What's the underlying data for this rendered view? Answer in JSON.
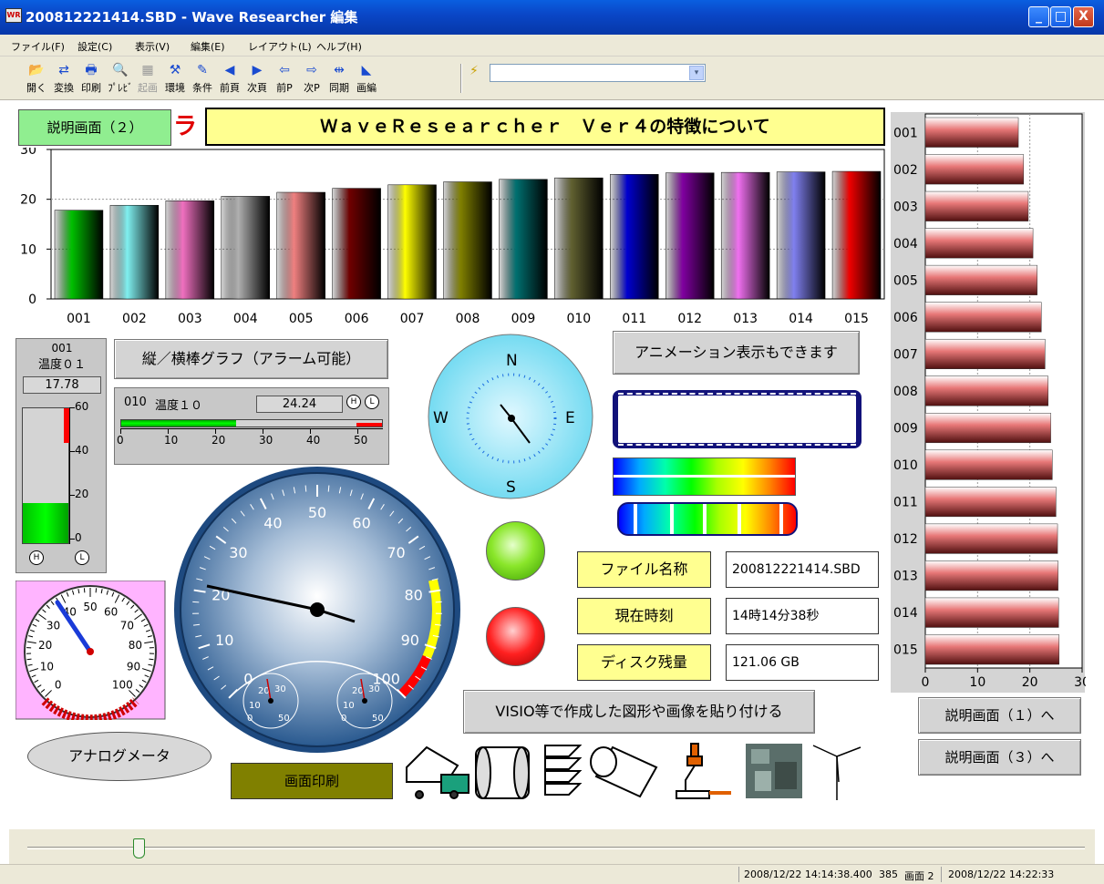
{
  "window": {
    "title": "200812221414.SBD - Wave Researcher 編集",
    "icon": "app-icon",
    "min": "_",
    "max": "□",
    "close": "X"
  },
  "menu": [
    "ファイル(F)",
    "設定(C)",
    "表示(V)",
    "編集(E)",
    "レイアウト(L)",
    "ヘルプ(H)"
  ],
  "toolbar": [
    {
      "label": "開く",
      "icon": "📂",
      "enabled": true
    },
    {
      "label": "変換",
      "icon": "⇄",
      "enabled": true
    },
    {
      "label": "印刷",
      "icon": "🖶",
      "enabled": true
    },
    {
      "label": "ﾌﾟﾚﾋﾞ",
      "icon": "🔍",
      "enabled": true
    },
    {
      "label": "起画",
      "icon": "▦",
      "enabled": false
    },
    {
      "label": "環境",
      "icon": "⚒",
      "enabled": true
    },
    {
      "label": "条件",
      "icon": "✎",
      "enabled": true
    },
    {
      "label": "前頁",
      "icon": "◀",
      "enabled": true
    },
    {
      "label": "次頁",
      "icon": "▶",
      "enabled": true
    },
    {
      "label": "前P",
      "icon": "⇦",
      "enabled": true
    },
    {
      "label": "次P",
      "icon": "⇨",
      "enabled": true
    },
    {
      "label": "同期",
      "icon": "⇹",
      "enabled": true
    },
    {
      "label": "画編",
      "icon": "◣",
      "enabled": true
    }
  ],
  "toolbar_combo": {
    "value": "",
    "arrow": "▾"
  },
  "canvas": {
    "explain_button": "説明画面（２）",
    "banner_partial": "ラ",
    "banner": "ＷａｖｅＲｅｓｅａｒｃｈｅｒ　Ｖｅｒ４の特徴について",
    "bar_chart_label": "縦／横棒グラフ（アラーム可能）",
    "anim_label": "アニメーション表示もできます",
    "analog_label": "アナログメータ",
    "print_button": "画面印刷",
    "visio_label": "VISIO等で作成した図形や画像を貼り付ける",
    "goto1": "説明画面（１）へ",
    "goto3": "説明画面（３）へ",
    "info": [
      {
        "key": "ファイル名称",
        "value": "200812221414.SBD"
      },
      {
        "key": "現在時刻",
        "value": "14時14分38秒"
      },
      {
        "key": "ディスク残量",
        "value": "121.06 GB"
      }
    ],
    "vgauge": {
      "id": "001",
      "name": "温度０１",
      "value": "17.78",
      "level": 17.78,
      "ticks": [
        "60",
        "40",
        "20",
        "0"
      ],
      "h": "H",
      "l": "L"
    },
    "hgauge": {
      "id": "010",
      "name": "温度１０",
      "value": "24.24",
      "level": 24.24,
      "ticks": [
        "0",
        "10",
        "20",
        "30",
        "40",
        "50"
      ],
      "h": "H",
      "l": "L"
    },
    "compass": {
      "n": "N",
      "e": "E",
      "s": "S",
      "w": "W"
    },
    "big_meter": {
      "ticks": [
        "0",
        "10",
        "20",
        "30",
        "40",
        "50",
        "60",
        "70",
        "80",
        "90",
        "100"
      ],
      "value": 17
    },
    "small_dial_ticks": [
      "10",
      "20",
      "30",
      "0",
      "50"
    ],
    "pink_meter": {
      "ticks": [
        "0",
        "10",
        "20",
        "30",
        "40",
        "50",
        "60",
        "70",
        "80",
        "90",
        "100"
      ]
    }
  },
  "status": {
    "time1": "2008/12/22 14:14:38.400",
    "count": "385",
    "screen": "画面 2",
    "time2": "2008/12/22  14:22:33"
  },
  "colors": {
    "bar_pink": "#e87878",
    "yellow": "#ffff90",
    "green_btn": "#90ee90"
  },
  "chart_data": [
    {
      "type": "bar",
      "categories": [
        "001",
        "002",
        "003",
        "004",
        "005",
        "006",
        "007",
        "008",
        "009",
        "010",
        "011",
        "012",
        "013",
        "014",
        "015"
      ],
      "values": [
        17.8,
        18.8,
        19.7,
        20.6,
        21.4,
        22.2,
        22.9,
        23.5,
        24.0,
        24.3,
        25.0,
        25.3,
        25.4,
        25.5,
        25.6
      ],
      "yticks": [
        "30",
        "20",
        "10",
        "0"
      ],
      "ylim": [
        0,
        30
      ]
    },
    {
      "type": "bar",
      "orientation": "horizontal",
      "categories": [
        "001",
        "002",
        "003",
        "004",
        "005",
        "006",
        "007",
        "008",
        "009",
        "010",
        "011",
        "012",
        "013",
        "014",
        "015"
      ],
      "values": [
        17.8,
        18.8,
        19.7,
        20.6,
        21.4,
        22.2,
        22.9,
        23.5,
        24.0,
        24.3,
        25.0,
        25.3,
        25.4,
        25.5,
        25.6
      ],
      "xticks": [
        "0",
        "10",
        "20",
        "30"
      ],
      "xlim": [
        0,
        30
      ]
    }
  ]
}
